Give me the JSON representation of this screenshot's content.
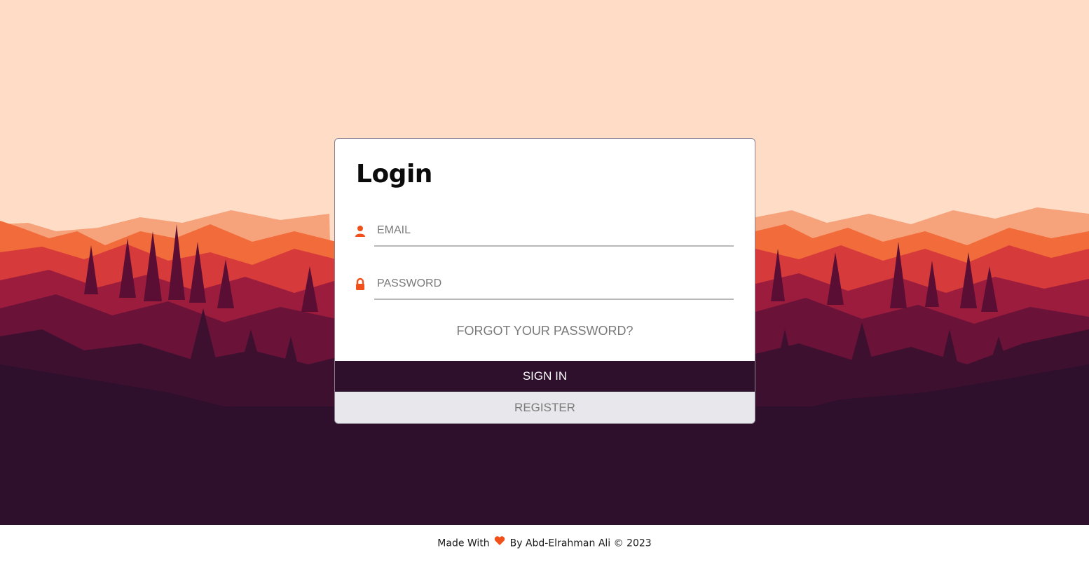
{
  "login": {
    "title": "Login",
    "email_placeholder": "EMAIL",
    "password_placeholder": "PASSWORD",
    "forgot_label": "FORGOT YOUR PASSWORD?",
    "signin_label": "SIGN IN",
    "register_label": "REGISTER"
  },
  "footer": {
    "prefix": "Made With",
    "suffix": "By Abd-Elrahman Ali © 2023"
  },
  "icons": {
    "email": "user-icon",
    "password": "lock-icon",
    "footer": "heart-icon"
  },
  "colors": {
    "accent": "#f0501a",
    "dark": "#2e0f2c",
    "sky": "#ffdcc6"
  }
}
